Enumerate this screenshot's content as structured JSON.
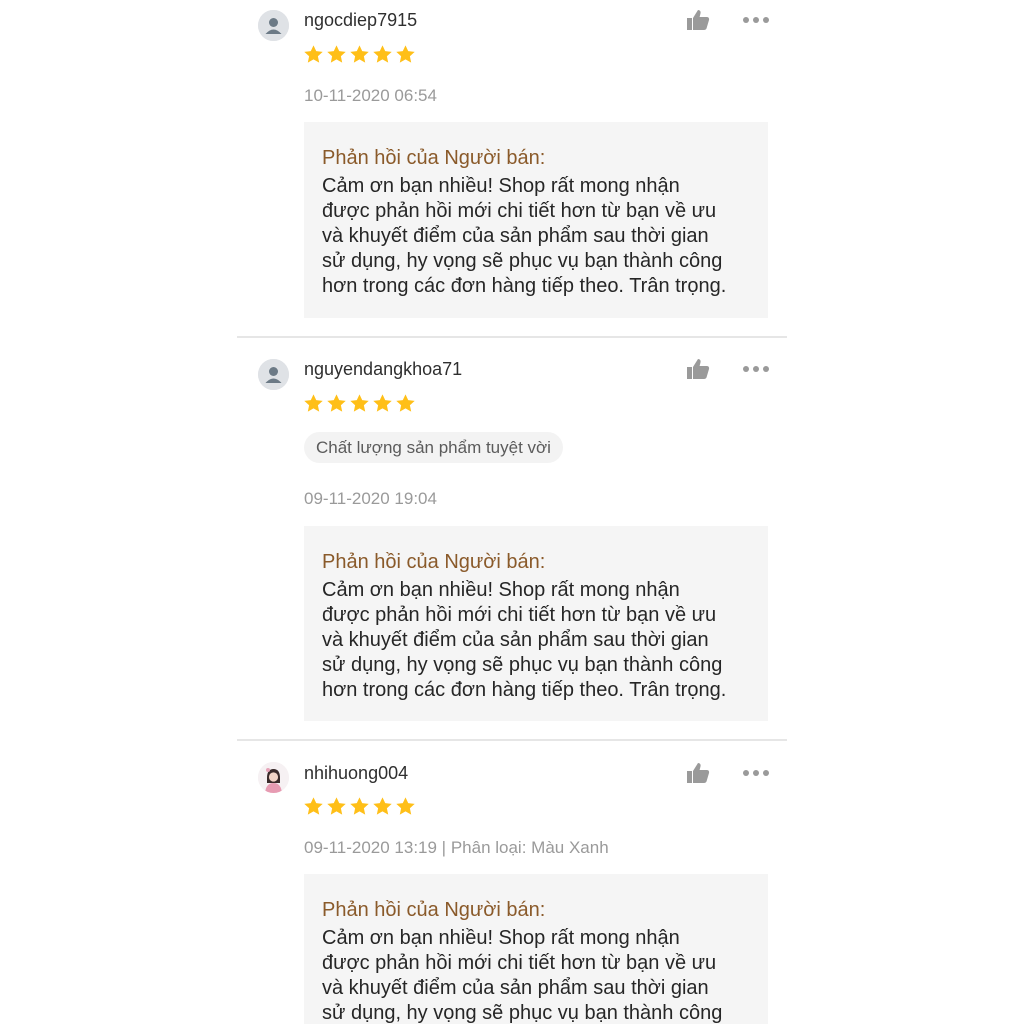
{
  "reviews": [
    {
      "username": "ngocdiep7915",
      "rating": 5,
      "tag": null,
      "meta": "10-11-2020 06:54",
      "reply_title": "Phản hồi của Người bán:",
      "reply_lines": [
        "Cảm ơn bạn nhiều! Shop rất mong nhận",
        "được phản hồi mới chi tiết hơn từ bạn về ưu",
        "và khuyết điểm của sản phẩm sau thời gian",
        "sử dụng, hy vọng sẽ phục vụ bạn thành công",
        "hơn trong các đơn hàng tiếp theo. Trân trọng."
      ]
    },
    {
      "username": "nguyendangkhoa71",
      "rating": 5,
      "tag": "Chất lượng sản phẩm tuyệt vời",
      "meta": "09-11-2020 19:04",
      "reply_title": "Phản hồi của Người bán:",
      "reply_lines": [
        "Cảm ơn bạn nhiều! Shop rất mong nhận",
        "được phản hồi mới chi tiết hơn từ bạn về ưu",
        "và khuyết điểm của sản phẩm sau thời gian",
        "sử dụng, hy vọng sẽ phục vụ bạn thành công",
        "hơn trong các đơn hàng tiếp theo. Trân trọng."
      ]
    },
    {
      "username": "nhihuong004",
      "rating": 5,
      "tag": null,
      "meta": "09-11-2020 13:19 | Phân loại: Màu Xanh",
      "reply_title": "Phản hồi của Người bán:",
      "reply_lines": [
        "Cảm ơn bạn nhiều! Shop rất mong nhận",
        "được phản hồi mới chi tiết hơn từ bạn về ưu",
        "và khuyết điểm của sản phẩm sau thời gian",
        "sử dụng, hy vọng sẽ phục vụ bạn thành công"
      ]
    }
  ],
  "colors": {
    "star": "#ffbf18",
    "reply_title": "#8a5a2a",
    "icon": "#9a9a9a"
  },
  "icons": [
    "default-avatar-icon",
    "user-avatar-photo",
    "thumbs-up-icon",
    "more-options-icon",
    "star-icon"
  ]
}
